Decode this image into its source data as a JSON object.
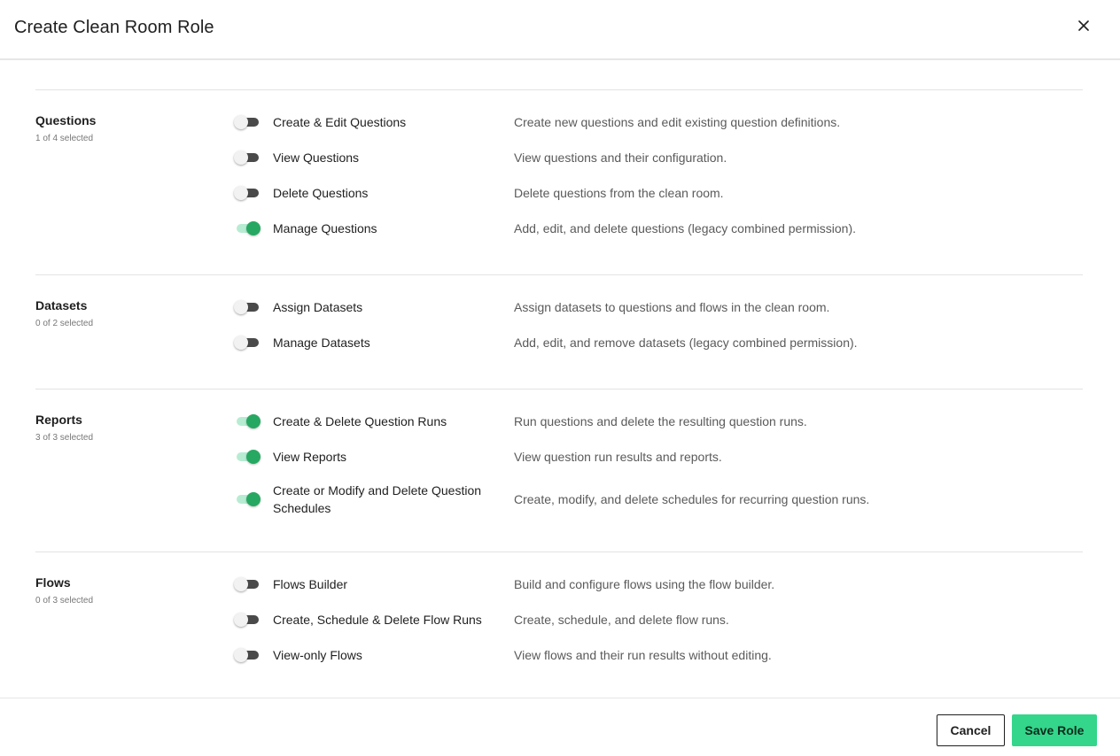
{
  "modal": {
    "title": "Create Clean Room Role",
    "close_icon": "close-icon"
  },
  "colors": {
    "toggle_on_knob": "#27a862",
    "toggle_on_track": "#b7ecd3",
    "toggle_off_track": "#4a4a4a",
    "save_button": "#33d68b"
  },
  "sections": [
    {
      "title": "Questions",
      "selected": "1 of 4 selected",
      "permissions": [
        {
          "label": "Create & Edit Questions",
          "description": "Create new questions and edit existing question definitions.",
          "enabled": false
        },
        {
          "label": "View Questions",
          "description": "View questions and their configuration.",
          "enabled": false
        },
        {
          "label": "Delete Questions",
          "description": "Delete questions from the clean room.",
          "enabled": false
        },
        {
          "label": "Manage Questions",
          "description": "Add, edit, and delete questions (legacy combined permission).",
          "enabled": true
        }
      ]
    },
    {
      "title": "Datasets",
      "selected": "0 of 2 selected",
      "permissions": [
        {
          "label": "Assign Datasets",
          "description": "Assign datasets to questions and flows in the clean room.",
          "enabled": false
        },
        {
          "label": "Manage Datasets",
          "description": "Add, edit, and remove datasets (legacy combined permission).",
          "enabled": false
        }
      ]
    },
    {
      "title": "Reports",
      "selected": "3 of 3 selected",
      "permissions": [
        {
          "label": "Create & Delete Question Runs",
          "description": "Run questions and delete the resulting question runs.",
          "enabled": true
        },
        {
          "label": "View Reports",
          "description": "View question run results and reports.",
          "enabled": true
        },
        {
          "label": "Create or Modify and Delete Question Schedules",
          "description": "Create, modify, and delete schedules for recurring question runs.",
          "enabled": true
        }
      ]
    },
    {
      "title": "Flows",
      "selected": "0 of 3 selected",
      "permissions": [
        {
          "label": "Flows Builder",
          "description": "Build and configure flows using the flow builder.",
          "enabled": false
        },
        {
          "label": "Create, Schedule & Delete Flow Runs",
          "description": "Create, schedule, and delete flow runs.",
          "enabled": false
        },
        {
          "label": "View-only Flows",
          "description": "View flows and their run results without editing.",
          "enabled": false
        }
      ]
    }
  ],
  "footer": {
    "cancel_label": "Cancel",
    "save_label": "Save Role"
  }
}
